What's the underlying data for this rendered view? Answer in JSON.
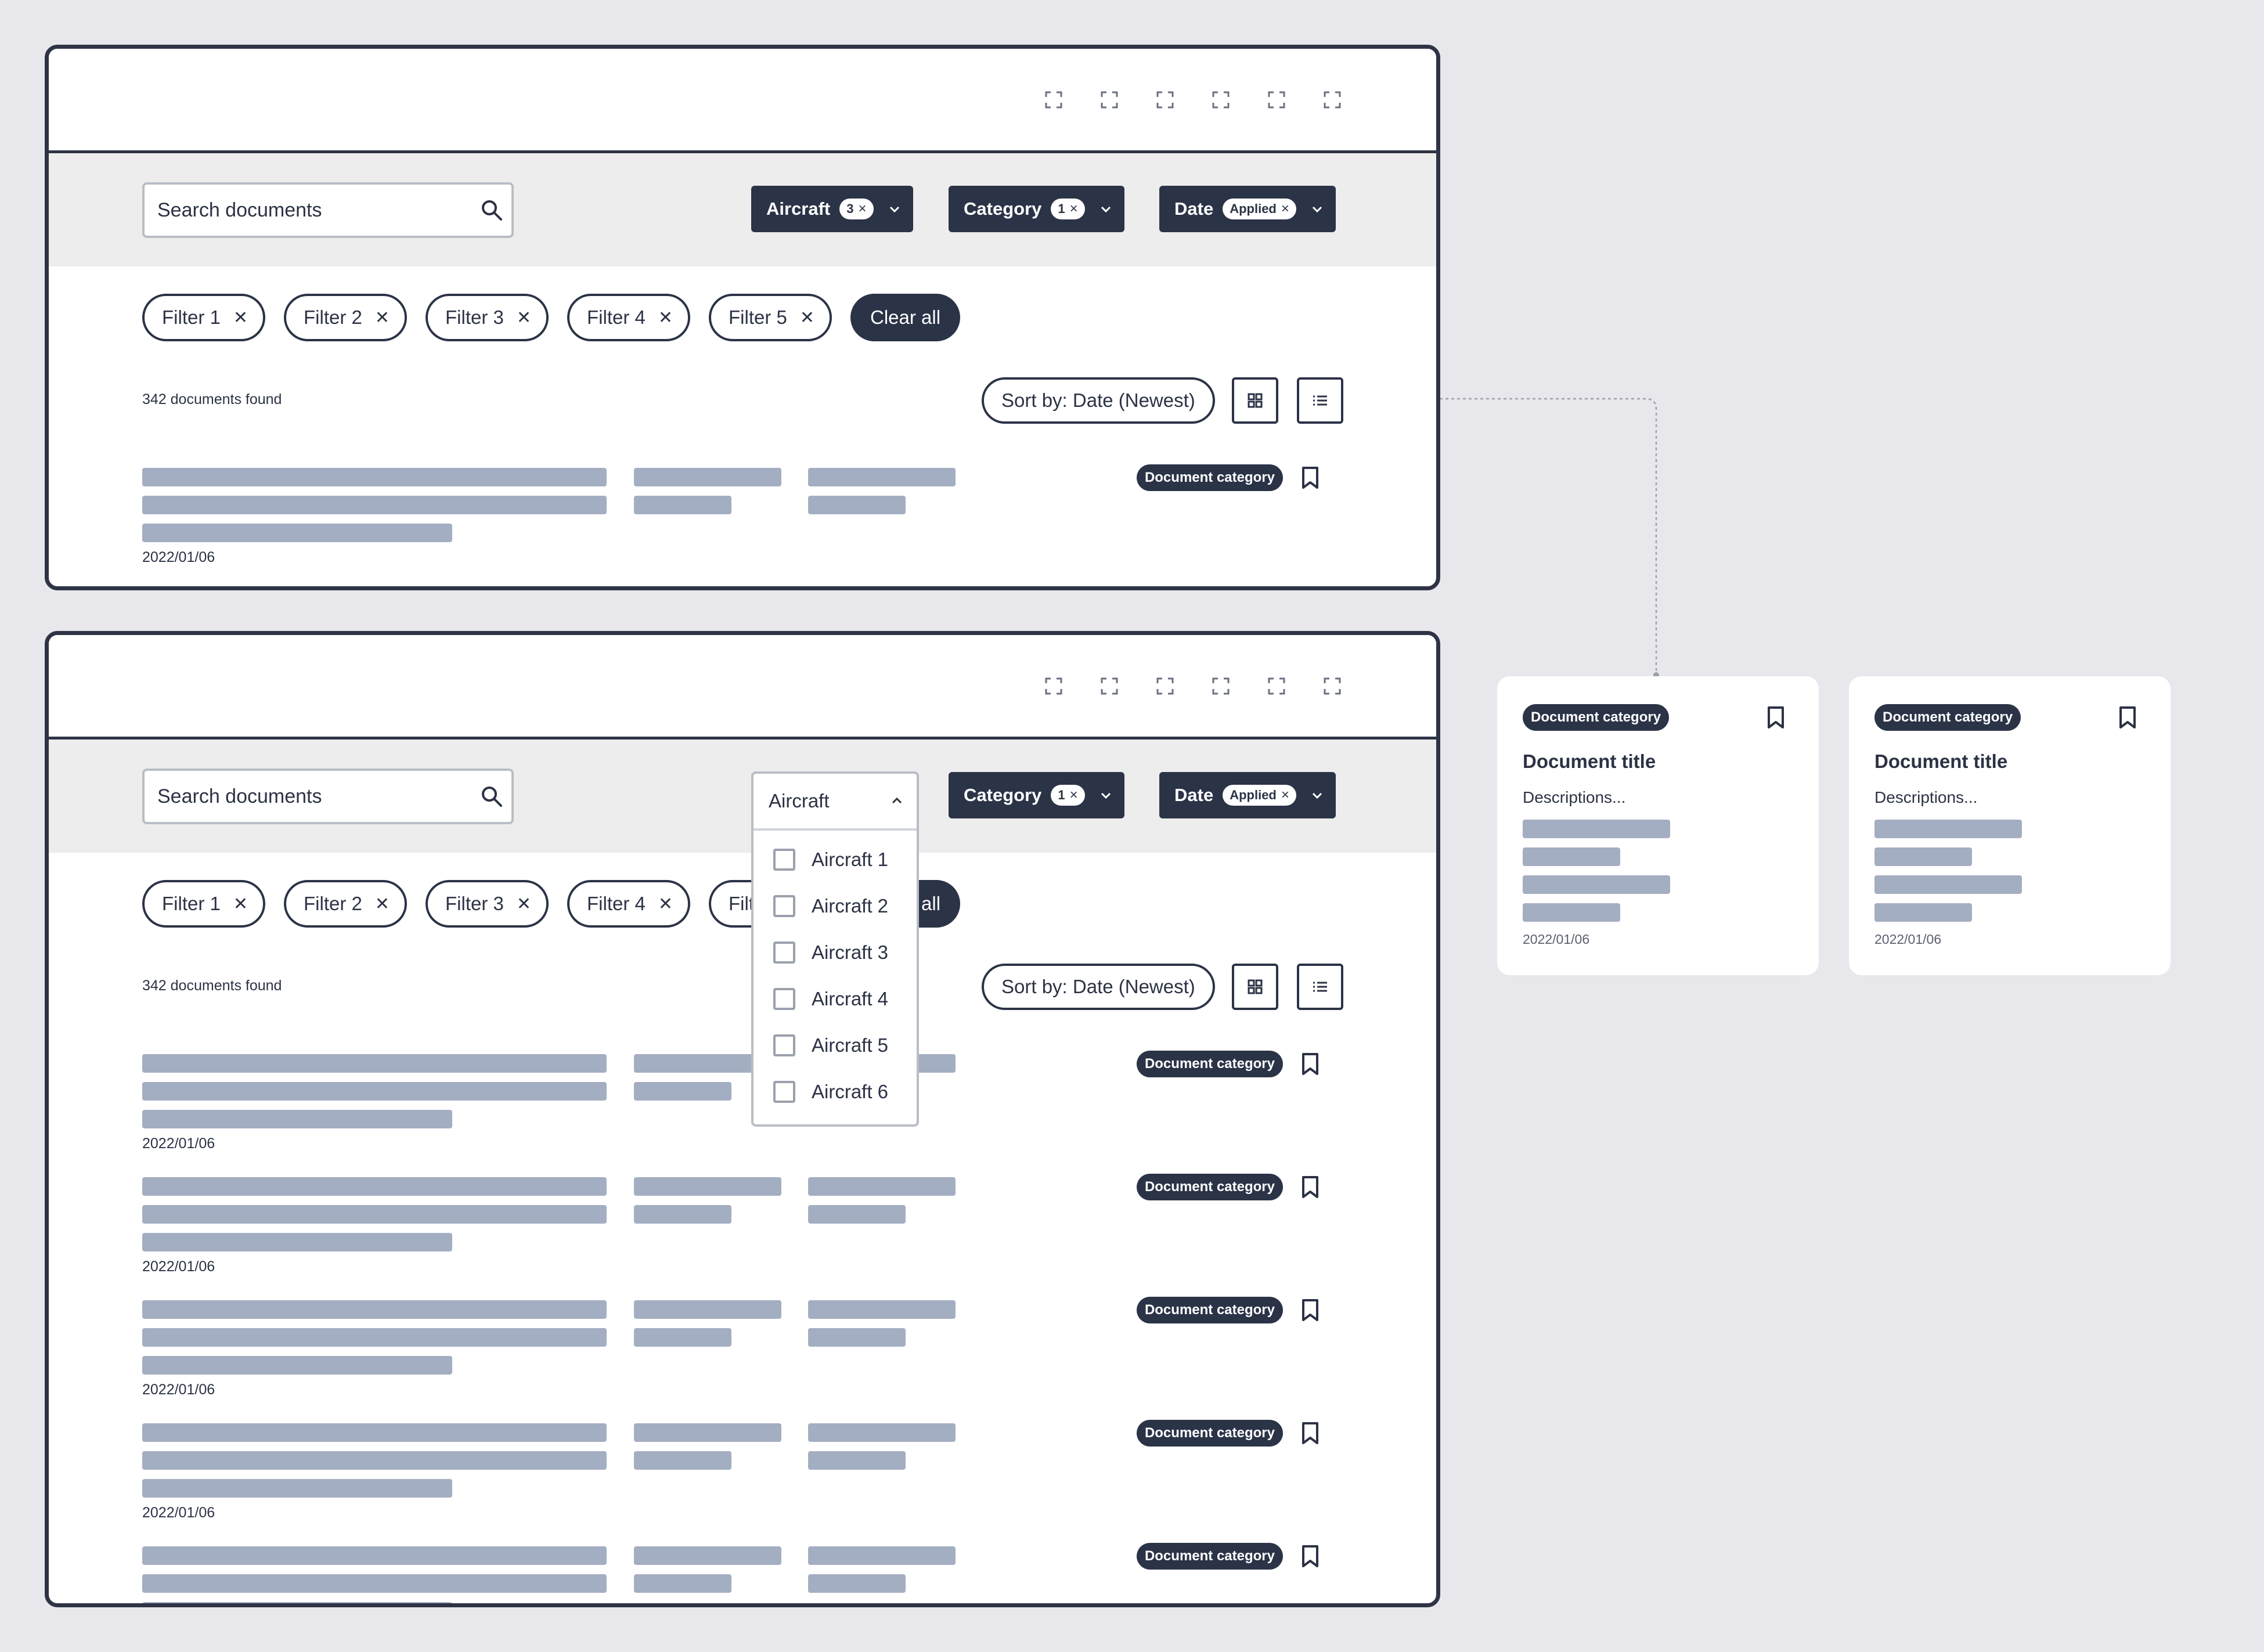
{
  "search": {
    "placeholder": "Search documents"
  },
  "dropdowns": {
    "aircraft": {
      "label": "Aircraft",
      "count": "3"
    },
    "category": {
      "label": "Category",
      "count": "1"
    },
    "date": {
      "label": "Date",
      "status": "Applied"
    }
  },
  "chips": [
    "Filter 1",
    "Filter 2",
    "Filter 3",
    "Filter 4",
    "Filter 5"
  ],
  "clear_all": "Clear all",
  "results": {
    "count": "342 documents found",
    "sort": "Sort by: Date (Newest)"
  },
  "row": {
    "category": "Document category",
    "date": "2022/01/06"
  },
  "aircraft_menu": {
    "label": "Aircraft",
    "options": [
      "Aircraft 1",
      "Aircraft 2",
      "Aircraft 3",
      "Aircraft 4",
      "Aircraft 5",
      "Aircraft 6"
    ]
  },
  "cards": [
    {
      "category": "Document category",
      "title": "Document title",
      "description": "Descriptions...",
      "date": "2022/01/06"
    },
    {
      "category": "Document category",
      "title": "Document title",
      "description": "Descriptions...",
      "date": "2022/01/06"
    }
  ],
  "colors": {
    "dark": "#2b3347",
    "skeleton": "#a4aec2",
    "canvas": "#e8e8ec",
    "filterbar": "#ededed"
  },
  "icons": {
    "topbar": [
      "focus-frame-icon",
      "focus-frame-icon",
      "focus-frame-icon",
      "focus-frame-icon",
      "focus-frame-icon",
      "focus-frame-icon"
    ],
    "search": "search-icon",
    "bookmark": "bookmark-icon",
    "grid": "grid-view-icon",
    "list": "list-view-icon"
  }
}
